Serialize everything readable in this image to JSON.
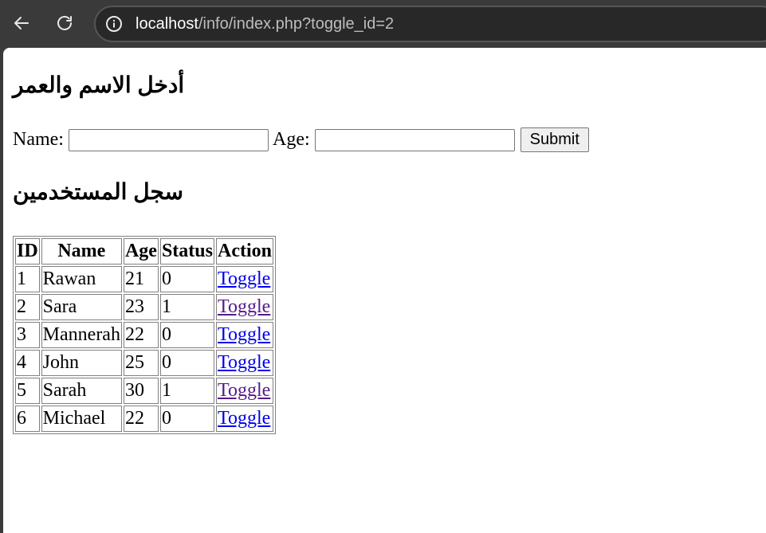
{
  "browser": {
    "url_host": "localhost",
    "url_path": "/info/index.php?toggle_id=2"
  },
  "form": {
    "heading": "أدخل الاسم والعمر",
    "name_label": "Name:",
    "name_value": "",
    "age_label": "Age:",
    "age_value": "",
    "submit_label": "Submit"
  },
  "log": {
    "heading": "سجل المستخدمين"
  },
  "table": {
    "headers": [
      "ID",
      "Name",
      "Age",
      "Status",
      "Action"
    ],
    "rows": [
      {
        "id": "1",
        "name": "Rawan",
        "age": "21",
        "status": "0",
        "action": "Toggle",
        "visited": false
      },
      {
        "id": "2",
        "name": "Sara",
        "age": "23",
        "status": "1",
        "action": "Toggle",
        "visited": true
      },
      {
        "id": "3",
        "name": "Mannerah",
        "age": "22",
        "status": "0",
        "action": "Toggle",
        "visited": false
      },
      {
        "id": "4",
        "name": "John",
        "age": "25",
        "status": "0",
        "action": "Toggle",
        "visited": false
      },
      {
        "id": "5",
        "name": "Sarah",
        "age": "30",
        "status": "1",
        "action": "Toggle",
        "visited": true
      },
      {
        "id": "6",
        "name": "Michael",
        "age": "22",
        "status": "0",
        "action": "Toggle",
        "visited": false
      }
    ]
  },
  "colors": {
    "link": "#0000ee",
    "visited_link": "#551a8b"
  }
}
